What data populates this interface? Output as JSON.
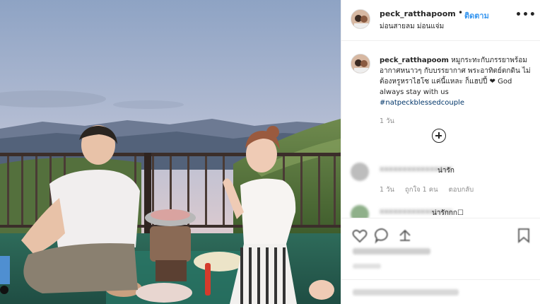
{
  "post": {
    "username": "peck_ratthapoom",
    "separator": "•",
    "follow_label": "ติดตาม",
    "location": "ม่อนสายลม ม่อนแจ่ม",
    "more_icon": "more-horizontal-icon"
  },
  "caption": {
    "username": "peck_ratthapoom",
    "text": "หมูกระทะกับภรรยาพร้อมอากาศหนาวๆ กับบรรยากาศ พระอาทิตย์ตกดิน ไม่ต้องหรูหราไฮโซ แค่นี้แหละ ก็แฮปปี้ ❤ God always stay with us",
    "hashtag": "#natpeckblessedcouple",
    "time": "1 วัน"
  },
  "load_more_icon": "plus-circle-icon",
  "comments": [
    {
      "text": "น่ารัก",
      "time": "1 วัน",
      "likes": "ถูกใจ 1 คน",
      "reply": "ตอบกลับ"
    },
    {
      "text": "น่ารักกก☐"
    }
  ],
  "actions": {
    "like_icon": "heart-icon",
    "comment_icon": "comment-icon",
    "share_icon": "share-icon",
    "save_icon": "bookmark-icon"
  },
  "colors": {
    "link": "#3897f0",
    "hashtag": "#003569",
    "muted": "#8e8e8e",
    "text": "#262626"
  }
}
